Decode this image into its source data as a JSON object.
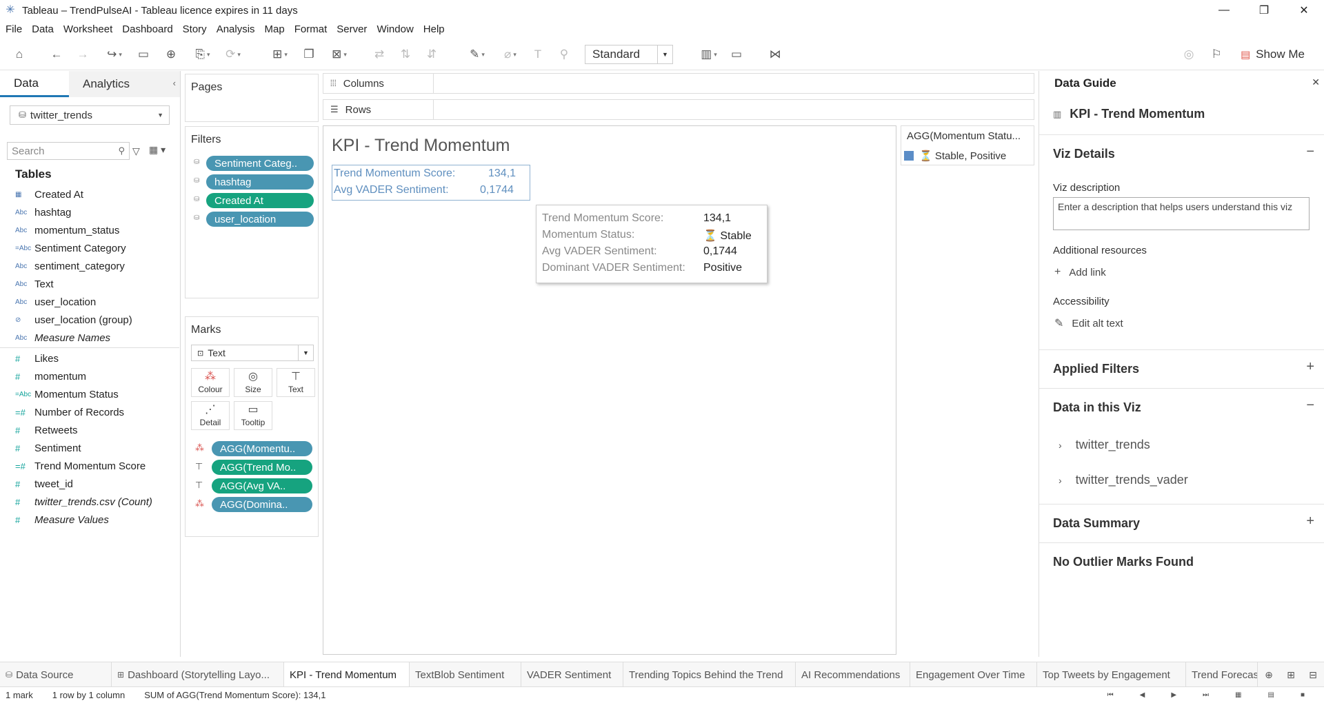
{
  "window": {
    "title": "Tableau – TrendPulseAI - Tableau licence expires in 11 days",
    "minimize": "—",
    "restore": "❐",
    "close": "✕"
  },
  "menu": [
    "File",
    "Data",
    "Worksheet",
    "Dashboard",
    "Story",
    "Analysis",
    "Map",
    "Format",
    "Server",
    "Window",
    "Help"
  ],
  "toolbar": {
    "fit_mode": "Standard",
    "show_me": "Show Me"
  },
  "data_pane": {
    "tab_data": "Data",
    "tab_analytics": "Analytics",
    "datasource": "twitter_trends",
    "search_placeholder": "Search",
    "tables_heading": "Tables",
    "dimensions": [
      {
        "type": "date",
        "name": "Created At"
      },
      {
        "type": "Abc",
        "name": "hashtag"
      },
      {
        "type": "Abc",
        "name": "momentum_status"
      },
      {
        "type": "=Abc",
        "name": "Sentiment Category"
      },
      {
        "type": "Abc",
        "name": "sentiment_category"
      },
      {
        "type": "Abc",
        "name": "Text"
      },
      {
        "type": "Abc",
        "name": "user_location"
      },
      {
        "type": "group",
        "name": "user_location (group)"
      },
      {
        "type": "Abc",
        "name": "Measure Names"
      }
    ],
    "measures": [
      {
        "type": "#",
        "name": "Likes"
      },
      {
        "type": "#",
        "name": "momentum"
      },
      {
        "type": "=Abc",
        "name": "Momentum Status"
      },
      {
        "type": "=#",
        "name": "Number of Records"
      },
      {
        "type": "#",
        "name": "Retweets"
      },
      {
        "type": "#",
        "name": "Sentiment"
      },
      {
        "type": "=#",
        "name": "Trend Momentum Score"
      },
      {
        "type": "#",
        "name": "tweet_id"
      },
      {
        "type": "#",
        "name": "twitter_trends.csv (Count)"
      },
      {
        "type": "#",
        "name": "Measure Values"
      }
    ]
  },
  "shelves": {
    "pages": "Pages",
    "filters": "Filters",
    "filter_pills": [
      "Sentiment Categ..",
      "hashtag",
      "Created At",
      "user_location"
    ],
    "marks": "Marks",
    "mark_type": "Text",
    "mark_buttons": [
      "Colour",
      "Size",
      "Text",
      "Detail",
      "Tooltip"
    ],
    "mark_pills": [
      "AGG(Momentu..",
      "AGG(Trend Mo..",
      "AGG(Avg VA..",
      "AGG(Domina.."
    ],
    "columns": "Columns",
    "rows": "Rows"
  },
  "viz": {
    "title": "KPI - Trend Momentum",
    "kpi_label_1": "Trend Momentum Score:",
    "kpi_value_1": "134,1",
    "kpi_label_2": "Avg VADER Sentiment:",
    "kpi_value_2": "0,1744",
    "tooltip": {
      "l1": "Trend Momentum Score:",
      "v1": "134,1",
      "l2": "Momentum Status:",
      "v2": "⏳ Stable",
      "l3": "Avg VADER Sentiment:",
      "v3": "0,1744",
      "l4": "Dominant VADER Sentiment:",
      "v4": "Positive"
    }
  },
  "legend": {
    "title": "AGG(Momentum Statu...",
    "item": "⏳ Stable, Positive",
    "swatch_color": "#5b8dc7"
  },
  "guide": {
    "title": "Data Guide",
    "sheet": "KPI - Trend Momentum",
    "viz_details": "Viz Details",
    "viz_description_label": "Viz description",
    "viz_description_placeholder": "Enter a description that helps users understand this viz",
    "additional_resources": "Additional resources",
    "add_link": "Add link",
    "accessibility": "Accessibility",
    "edit_alt_text": "Edit alt text",
    "applied_filters": "Applied Filters",
    "data_in_viz": "Data in this Viz",
    "datasources": [
      "twitter_trends",
      "twitter_trends_vader"
    ],
    "data_summary": "Data Summary",
    "outliers": "No Outlier Marks Found"
  },
  "sheet_tabs": [
    {
      "label": "Data Source",
      "icon": "⛁"
    },
    {
      "label": "Dashboard (Storytelling Layo...",
      "icon": "⊞"
    },
    {
      "label": "KPI - Trend Momentum",
      "icon": ""
    },
    {
      "label": "TextBlob Sentiment",
      "icon": ""
    },
    {
      "label": "VADER Sentiment",
      "icon": ""
    },
    {
      "label": "Trending Topics Behind the Trend",
      "icon": ""
    },
    {
      "label": "AI Recommendations",
      "icon": ""
    },
    {
      "label": "Engagement Over Time",
      "icon": ""
    },
    {
      "label": "Top Tweets by Engagement",
      "icon": ""
    },
    {
      "label": "Trend Forecas",
      "icon": ""
    }
  ],
  "status": {
    "marks": "1 mark",
    "dims": "1 row  by  1 column",
    "sum": "SUM of AGG(Trend Momentum Score): 134,1"
  }
}
